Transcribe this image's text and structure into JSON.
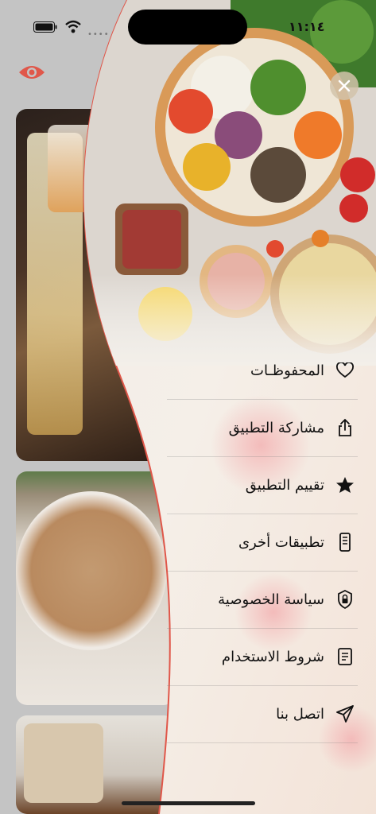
{
  "status_bar": {
    "time": "١١:١٤",
    "signal_dots": "••••"
  },
  "header": {
    "eye_icon": "eye-icon"
  },
  "drawer": {
    "close_icon": "close-icon",
    "menu": [
      {
        "label": "المحفوظـات",
        "icon": "heart-icon"
      },
      {
        "label": "مشاركة التطبيق",
        "icon": "share-icon"
      },
      {
        "label": "تقييم التطبيق",
        "icon": "star-icon"
      },
      {
        "label": "تطبيقات أخرى",
        "icon": "phone-icon"
      },
      {
        "label": "سياسة الخصوصية",
        "icon": "lock-icon"
      },
      {
        "label": "شروط الاستخدام",
        "icon": "document-icon"
      },
      {
        "label": "اتصل بنا",
        "icon": "send-icon"
      }
    ]
  },
  "colors": {
    "accent": "#e0574a",
    "drawer_edge": "#e0574a"
  }
}
